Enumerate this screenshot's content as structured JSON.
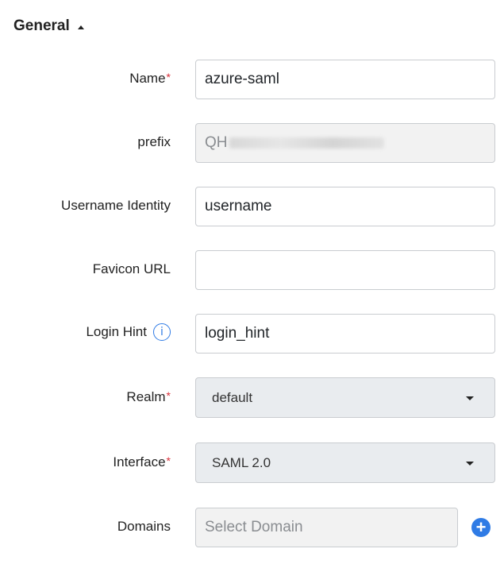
{
  "section": {
    "title": "General"
  },
  "fields": {
    "name": {
      "label": "Name",
      "required": "*",
      "value": "azure-saml"
    },
    "prefix": {
      "label": "prefix",
      "value": "QH"
    },
    "username_identity": {
      "label": "Username Identity",
      "value": "username"
    },
    "favicon_url": {
      "label": "Favicon URL",
      "value": ""
    },
    "login_hint": {
      "label": "Login Hint",
      "value": "login_hint",
      "info_icon": "i"
    },
    "realm": {
      "label": "Realm",
      "required": "*",
      "value": "default"
    },
    "interface": {
      "label": "Interface",
      "required": "*",
      "value": "SAML 2.0"
    },
    "domains": {
      "label": "Domains",
      "placeholder": "Select Domain",
      "add_icon": "+"
    }
  },
  "colors": {
    "accent": "#2f7be5",
    "required": "#d9303a"
  }
}
